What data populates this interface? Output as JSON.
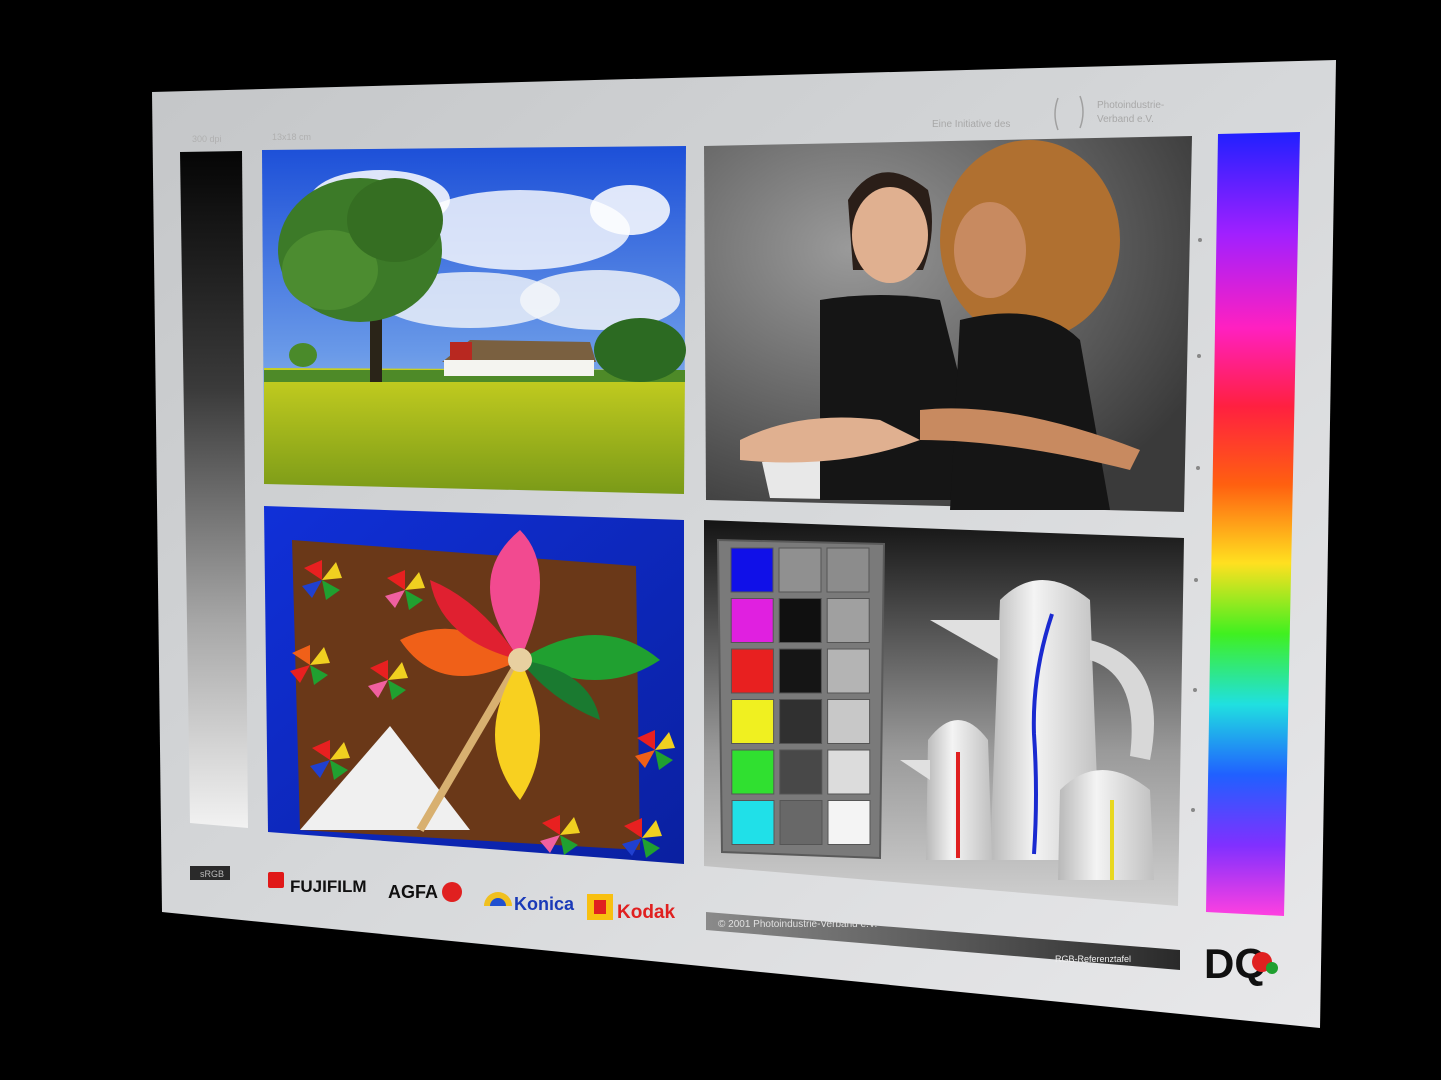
{
  "header": {
    "top_left_1": "300 dpi",
    "top_left_2": "13x18 cm",
    "initiative": "Eine Initiative des",
    "org_line_1": "Photoindustrie-",
    "org_line_2": "Verband e.V."
  },
  "footer": {
    "srgb": "sRGB",
    "copyright": "© 2001 Photoindustrie-Verband e.V.",
    "title": "RGB-Referenztafel"
  },
  "logos": {
    "fujifilm": "FUJIFILM",
    "agfa": "AGFA",
    "konica": "Konica",
    "kodak": "Kodak",
    "dq": "DQ"
  },
  "patches": {
    "colors": [
      "#1010e8",
      "#e020e0",
      "#e82020",
      "#f0f020",
      "#30e030",
      "#20e0e8"
    ],
    "gray_mid": [
      "#909090",
      "#101010",
      "#151515",
      "#303030",
      "#484848",
      "#686868"
    ],
    "gray_right": [
      "#8c8c8c",
      "#a0a0a0",
      "#b4b4b4",
      "#c8c8c8",
      "#dcdcdc",
      "#f4f4f4"
    ]
  }
}
